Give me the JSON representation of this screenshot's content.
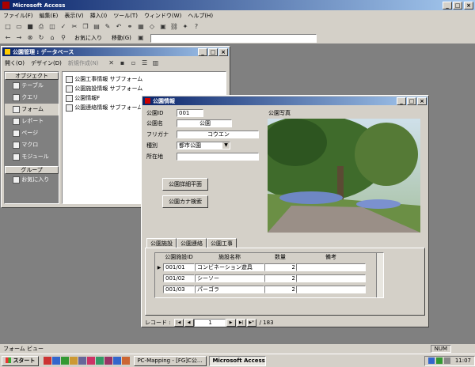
{
  "app": {
    "title": "Microsoft Access"
  },
  "menu": [
    "ファイル(F)",
    "編集(E)",
    "表示(V)",
    "挿入(I)",
    "ツール(T)",
    "ウィンドウ(W)",
    "ヘルプ(H)"
  ],
  "toolbar2": {
    "favorites": "お気に入り",
    "goto": "移動(G)"
  },
  "db_window": {
    "title": "公園管理 : データベース",
    "open": "開く(O)",
    "design": "デザイン(D)",
    "new": "新規作成(N)",
    "objects_header": "オブジェクト",
    "objects": [
      "テーブル",
      "クエリ",
      "フォーム",
      "レポート",
      "ページ",
      "マクロ",
      "モジュール"
    ],
    "groups_header": "グループ",
    "favorites": "お気に入り",
    "items": [
      "公園工事情報 サブフォーム",
      "公園施設情報 サブフォーム",
      "公園情報F",
      "公園連絡情報 サブフォーム"
    ]
  },
  "form": {
    "title": "公園情報",
    "labels": {
      "id": "公園ID",
      "name": "公園名",
      "furigana": "フリガナ",
      "type": "種別",
      "address": "所在地",
      "photo": "公園写真"
    },
    "values": {
      "id": "001",
      "name": "公園",
      "furigana": "コウエン",
      "type": "都市公園",
      "address": ""
    },
    "buttons": {
      "detail": "公園詳細平面",
      "kana": "公園カナ検索"
    },
    "tabs": [
      "公園施設",
      "公園連絡",
      "公園工事"
    ],
    "subform": {
      "headers": [
        "公園施設ID",
        "施設名称",
        "数量",
        "備考"
      ],
      "rows": [
        [
          "001/01",
          "コンビネーション遊具",
          "2",
          ""
        ],
        [
          "001/02",
          "シーソー",
          "2",
          ""
        ],
        [
          "001/03",
          "パーゴラ",
          "2",
          ""
        ]
      ]
    },
    "nav": {
      "label": "レコード :",
      "current": "1",
      "total": "/ 183"
    }
  },
  "status": {
    "text": "フォーム ビュー",
    "num": "NUM"
  },
  "taskbar": {
    "start": "スタート",
    "items": [
      "PC-Mapping - [FG]C公...",
      "Microsoft Access"
    ],
    "time": "11:07"
  }
}
